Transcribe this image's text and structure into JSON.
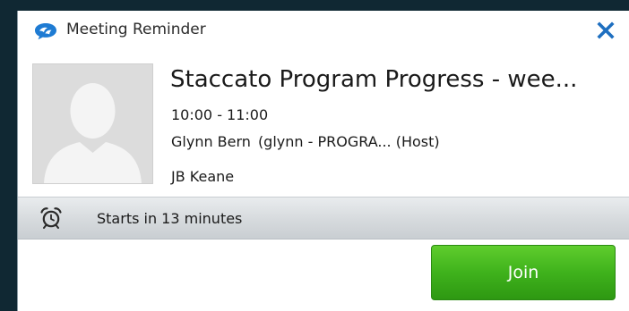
{
  "window": {
    "title": "Meeting Reminder",
    "app_icon": "lync-chat-bubble-icon",
    "close_icon": "close-icon"
  },
  "meeting": {
    "title": "Staccato Program Progress - wee...",
    "time": "10:00 - 11:00",
    "organizer_name": "Glynn Bern",
    "organizer_detail": "(glynn - PROGRA... (Host)",
    "attendee": "JB Keane",
    "avatar": "default-person-avatar"
  },
  "status": {
    "icon": "alarm-clock-icon",
    "text": "Starts in 13 minutes"
  },
  "actions": {
    "join_label": "Join"
  },
  "colors": {
    "accent_blue": "#1e7bd3",
    "join_green": "#3fb21c",
    "background_dark": "#102833"
  }
}
